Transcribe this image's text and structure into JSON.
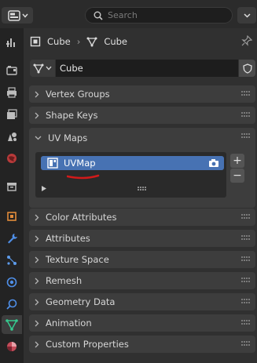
{
  "header": {
    "search_placeholder": "Search",
    "editor_type_icon": "properties-editor-icon",
    "options_icon": "chevron-down-icon"
  },
  "breadcrumb": {
    "object_name": "Cube",
    "data_name": "Cube"
  },
  "datablock": {
    "name": "Cube"
  },
  "panels": [
    {
      "label": "Vertex Groups",
      "expanded": false
    },
    {
      "label": "Shape Keys",
      "expanded": false
    },
    {
      "label": "UV Maps",
      "expanded": true
    },
    {
      "label": "Color Attributes",
      "expanded": false
    },
    {
      "label": "Attributes",
      "expanded": false
    },
    {
      "label": "Texture Space",
      "expanded": false
    },
    {
      "label": "Remesh",
      "expanded": false
    },
    {
      "label": "Geometry Data",
      "expanded": false
    },
    {
      "label": "Animation",
      "expanded": false
    },
    {
      "label": "Custom Properties",
      "expanded": false
    }
  ],
  "uv_maps": {
    "items": [
      {
        "name": "UVMap",
        "selected": true,
        "active_render": true
      }
    ],
    "add_label": "+",
    "remove_label": "−"
  },
  "colors": {
    "accent_selection": "#4772b3",
    "annotation_stroke": "#d11a1a",
    "active_tab_icon": "#36c98f"
  }
}
